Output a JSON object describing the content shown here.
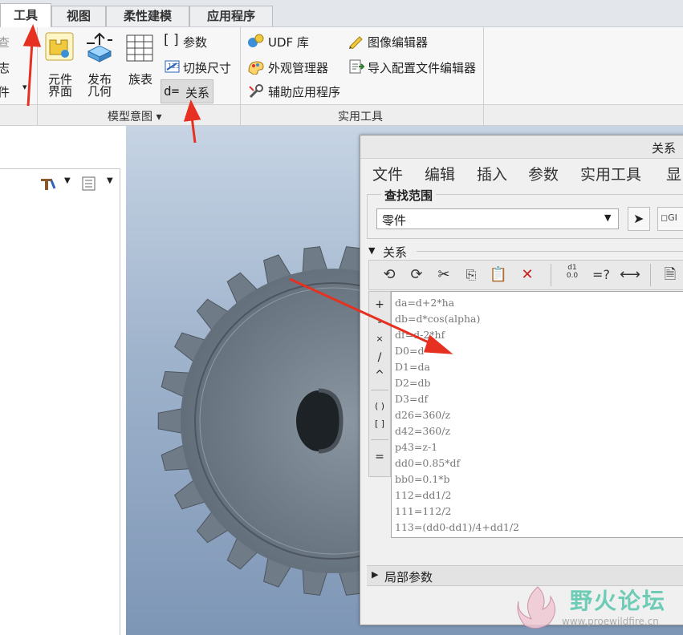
{
  "tabs": [
    "工具",
    "视图",
    "柔性建模",
    "应用程序"
  ],
  "ribbon": {
    "left_group_items": [
      "检查",
      "日志",
      "零件"
    ],
    "big_buttons": [
      {
        "label1": "元件",
        "label2": "界面"
      },
      {
        "label1": "发布",
        "label2": "几何"
      },
      {
        "label1": "族表",
        "label2": ""
      }
    ],
    "model_intent_items": [
      "参数",
      "切换尺寸",
      "关系"
    ],
    "relations_prefix": "d=",
    "utility_items": [
      "UDF 库",
      "外观管理器",
      "辅助应用程序",
      "图像编辑器",
      "导入配置文件编辑器"
    ],
    "group_labels": [
      "模型意图 ▾",
      "实用工具"
    ]
  },
  "dialog": {
    "title": "关系",
    "menus": [
      "文件",
      "编辑",
      "插入",
      "参数",
      "实用工具",
      "显"
    ],
    "find_scope_label": "查找范围",
    "scope_value": "零件",
    "relations_section": "关系",
    "local_params_section": "局部参数",
    "operators": [
      "+",
      "-",
      "×",
      "/",
      "^",
      "( )",
      "[ ]",
      "="
    ],
    "relations": [
      "da=d+2*ha",
      "db=d*cos(alpha)",
      "df=d-2*hf",
      "D0=d",
      "D1=da",
      "D2=db",
      "D3=df",
      "d26=360/z",
      "d42=360/z",
      "p43=z-1",
      "dd0=0.85*df",
      "bb0=0.1*b",
      "112=dd1/2",
      "111=112/2",
      "113=(dd0-dd1)/4+dd1/2"
    ],
    "toolbar_text": {
      "eq_q": "=?"
    }
  },
  "watermark": {
    "title": "野火论坛",
    "url": "www.proewildfire.cn"
  },
  "colors": {
    "accent_red": "#e63021",
    "viewport_top": "#c6d4e4",
    "gear": "#6f7b86"
  }
}
